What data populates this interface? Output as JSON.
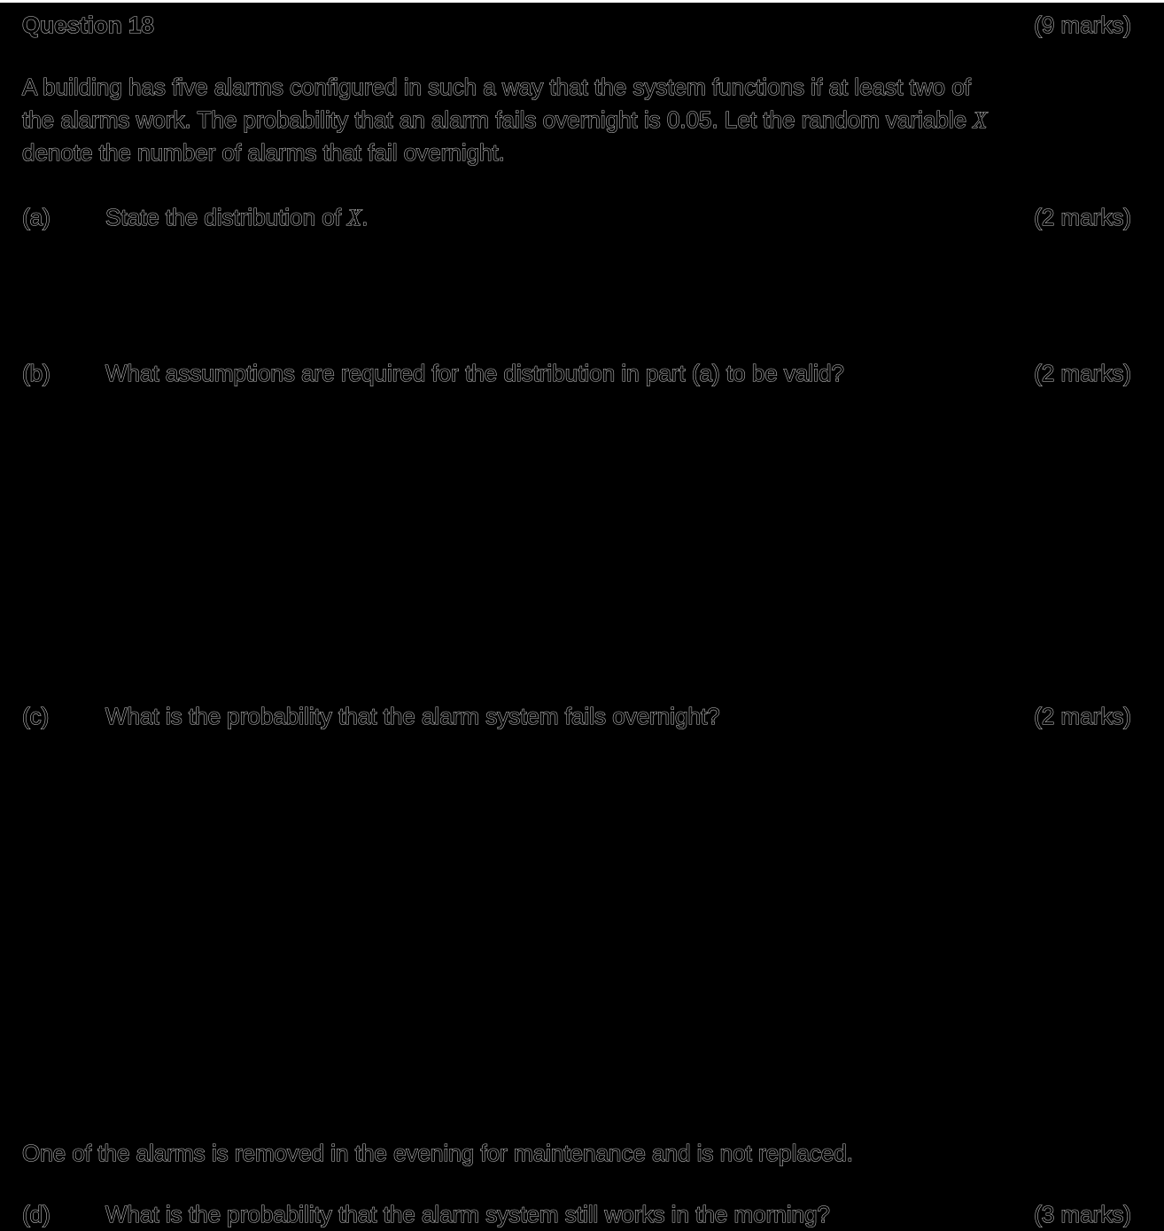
{
  "question": {
    "title": "Question 18",
    "marks": "(9 marks)"
  },
  "stem": {
    "line1": "A building has five alarms configured in such a way that the system functions if at least two of",
    "line2_pre": "the alarms work. The probability that an alarm fails overnight is 0.05. Let the random variable ",
    "variable": "X",
    "line3": "denote the number of alarms that fail overnight."
  },
  "parts": {
    "a": {
      "label": "(a)",
      "text_pre": "State the distribution of ",
      "variable": "X",
      "text_post": ".",
      "marks": "(2 marks)"
    },
    "b": {
      "label": "(b)",
      "text": "What assumptions are required for the distribution in part (a) to be valid?",
      "marks": "(2 marks)"
    },
    "c": {
      "label": "(c)",
      "text": "What is the probability that the alarm system fails overnight?",
      "marks": "(2 marks)"
    },
    "d": {
      "label": "(d)",
      "text": "What is the probability that the alarm system still works in the morning?",
      "marks": "(3 marks)"
    }
  },
  "interlude": "One of the alarms is removed in the evening for maintenance and is not replaced."
}
